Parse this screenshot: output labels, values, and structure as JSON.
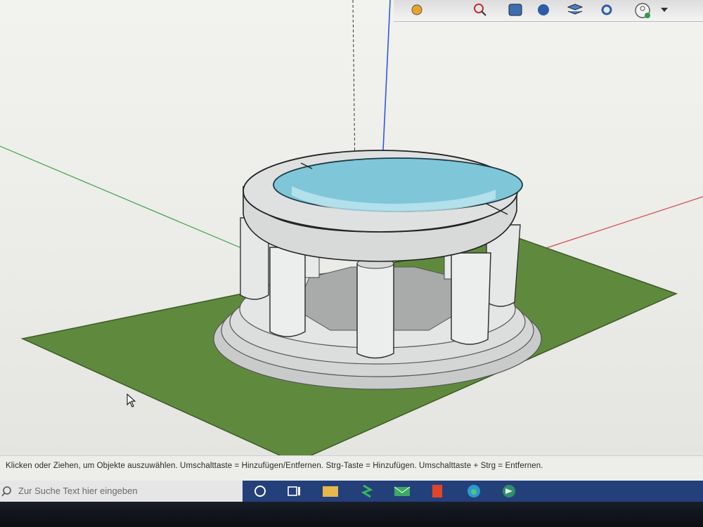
{
  "status_bar": {
    "hint": "Klicken oder Ziehen, um Objekte auszuwählen. Umschalttaste = Hinzufügen/Entfernen. Strg-Taste = Hinzufügen. Umschalttaste + Strg = Entfernen."
  },
  "taskbar": {
    "search_placeholder": "Zur Suche Text hier eingeben",
    "apps": [
      "cortana-icon",
      "task-view-icon",
      "file-explorer-icon",
      "app-s-icon",
      "mail-icon",
      "office-icon",
      "edge-icon",
      "sketchup-icon"
    ]
  },
  "toolbar": {
    "icons": [
      "paint-bucket-icon",
      "zoom-tool-icon",
      "layers-tool-icon",
      "walk-tool-icon",
      "settings-tool-icon",
      "profile-icon",
      "dropdown-arrow-icon"
    ]
  },
  "colors": {
    "ground": "#5f8a3e",
    "model_fill": "#e2e4e2",
    "water": "#7fc6d8",
    "blue_axis": "#2e57e8",
    "green_axis": "#3aa24a",
    "red_axis": "#d24a4a",
    "taskbar_blue": "#24407a"
  }
}
